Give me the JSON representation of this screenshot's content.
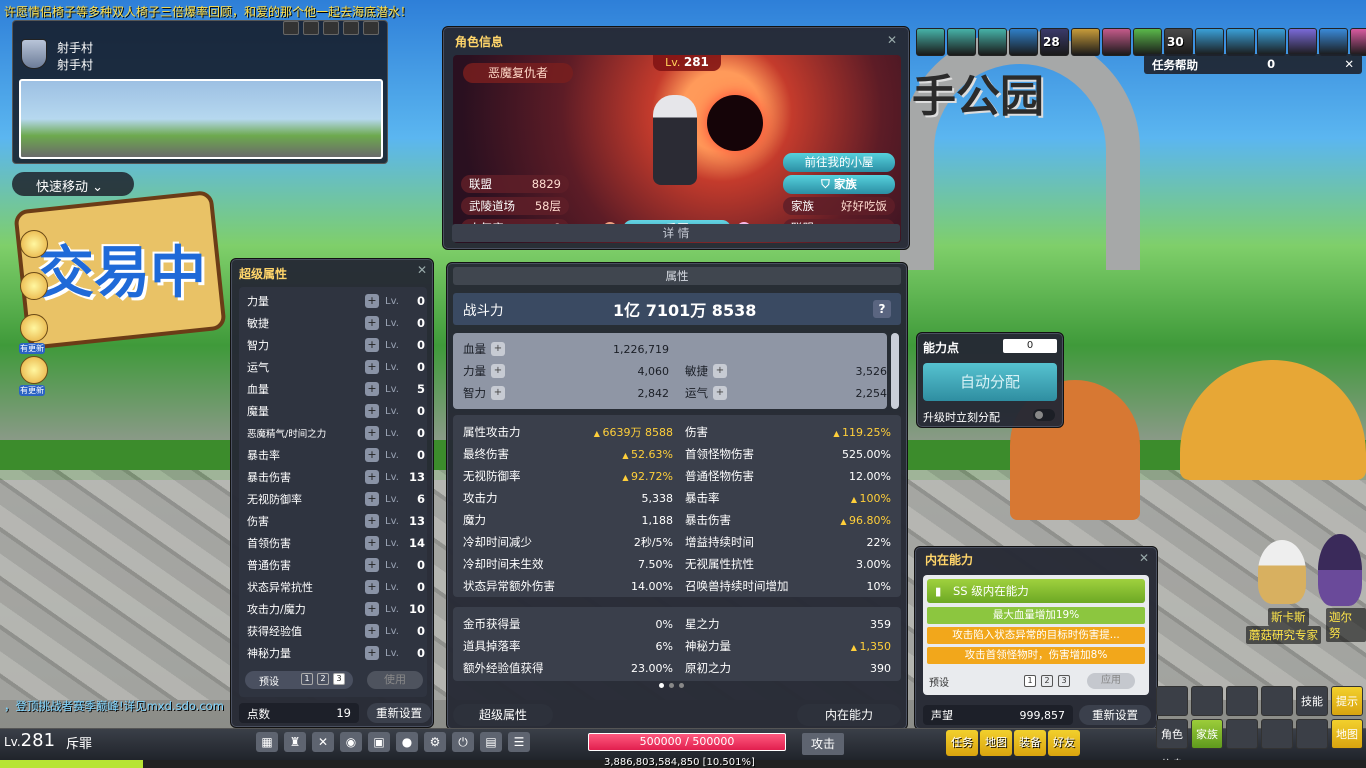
{
  "ticker": "许愿情侣椅子等多种双人椅子三倍爆率回顾，和爱的那个他一起去海底潜水！",
  "minimap": {
    "area_line1": "射手村",
    "area_line2": "射手村"
  },
  "quick_move": "快速移动",
  "side_icons": [
    {
      "icon": "lightbulb-icon",
      "badge": ""
    },
    {
      "icon": "star-icon",
      "badge": ""
    },
    {
      "icon": "bell-icon",
      "badge": "有更新"
    },
    {
      "icon": "megaphone-icon",
      "badge": "有更新"
    }
  ],
  "backdrop": {
    "sign_text": "交易中",
    "arch_text": "手公园"
  },
  "super_stats": {
    "title": "超级属性",
    "lv_label": "Lv.",
    "rows": [
      {
        "name": "力量",
        "level": "0"
      },
      {
        "name": "敏捷",
        "level": "0"
      },
      {
        "name": "智力",
        "level": "0"
      },
      {
        "name": "运气",
        "level": "0"
      },
      {
        "name": "血量",
        "level": "5"
      },
      {
        "name": "魔量",
        "level": "0"
      },
      {
        "name": "恶魔精气/时间之力",
        "level": "0"
      },
      {
        "name": "暴击率",
        "level": "0"
      },
      {
        "name": "暴击伤害",
        "level": "13"
      },
      {
        "name": "无视防御率",
        "level": "6"
      },
      {
        "name": "伤害",
        "level": "13"
      },
      {
        "name": "首领伤害",
        "level": "14"
      },
      {
        "name": "普通伤害",
        "level": "0"
      },
      {
        "name": "状态异常抗性",
        "level": "0"
      },
      {
        "name": "攻击力/魔力",
        "level": "10"
      },
      {
        "name": "获得经验值",
        "level": "0"
      },
      {
        "name": "神秘力量",
        "level": "0"
      }
    ],
    "preset_label": "预设",
    "presets": [
      "1",
      "2",
      "3"
    ],
    "use_button": "使用",
    "points_label": "点数",
    "points_value": "19",
    "reset_button": "重新设置"
  },
  "char_info": {
    "title": "角色信息",
    "class_name": "恶魔复仇者",
    "level_prefix": "Lv.",
    "level": "281",
    "home_button": "前往我的小屋",
    "family_button": "家族",
    "left_stats": [
      {
        "label": "联盟",
        "value": "8829"
      },
      {
        "label": "武陵道场",
        "value": "58层"
      },
      {
        "label": "人气度",
        "value": "8"
      }
    ],
    "right_stats": [
      {
        "label": "家族",
        "value": "好好吃饭"
      },
      {
        "label": "联盟",
        "value": "-"
      }
    ],
    "character_name": "斥罪",
    "detail_button": "详 情"
  },
  "attributes": {
    "tab": "属性",
    "combat_power_label": "战斗力",
    "combat_power_value": "1亿 7101万 8538",
    "help": "?",
    "base": {
      "hp_label": "血量",
      "hp_value": "1,226,719",
      "str_label": "力量",
      "str_value": "4,060",
      "dex_label": "敏捷",
      "dex_value": "3,526",
      "int_label": "智力",
      "int_value": "2,842",
      "luk_label": "运气",
      "luk_value": "2,254"
    },
    "advanced": [
      {
        "l": "属性攻击力",
        "lv": "6639万 8588",
        "lu": true,
        "r": "伤害",
        "rv": "119.25%",
        "ru": true
      },
      {
        "l": "最终伤害",
        "lv": "52.63%",
        "lu": true,
        "r": "首领怪物伤害",
        "rv": "525.00%",
        "ru": false
      },
      {
        "l": "无视防御率",
        "lv": "92.72%",
        "lu": true,
        "r": "普通怪物伤害",
        "rv": "12.00%",
        "ru": false
      },
      {
        "l": "攻击力",
        "lv": "5,338",
        "lu": false,
        "r": "暴击率",
        "rv": "100%",
        "ru": true
      },
      {
        "l": "魔力",
        "lv": "1,188",
        "lu": false,
        "r": "暴击伤害",
        "rv": "96.80%",
        "ru": true
      },
      {
        "l": "冷却时间减少",
        "lv": "2秒/5%",
        "lu": false,
        "r": "增益持续时间",
        "rv": "22%",
        "ru": false
      },
      {
        "l": "冷却时间未生效",
        "lv": "7.50%",
        "lu": false,
        "r": "无视属性抗性",
        "rv": "3.00%",
        "ru": false
      },
      {
        "l": "状态异常额外伤害",
        "lv": "14.00%",
        "lu": false,
        "r": "召唤兽持续时间增加",
        "rv": "10%",
        "ru": false
      }
    ],
    "misc": [
      {
        "l": "金币获得量",
        "lv": "0%",
        "lu": false,
        "r": "星之力",
        "rv": "359",
        "ru": false
      },
      {
        "l": "道具掉落率",
        "lv": "6%",
        "lu": false,
        "r": "神秘力量",
        "rv": "1,350",
        "ru": true
      },
      {
        "l": "额外经验值获得",
        "lv": "23.00%",
        "lu": false,
        "r": "原初之力",
        "rv": "390",
        "ru": false
      }
    ],
    "footer_left": "超级属性",
    "footer_right": "内在能力"
  },
  "ability_points": {
    "title": "能力点",
    "value": "0",
    "auto_button": "自动分配",
    "auto_upgrade_label": "升级时立刻分配"
  },
  "inner_ability": {
    "title": "内在能力",
    "rank": "SS 级内在能力",
    "lines": [
      {
        "text": "最大血量增加19%",
        "color": "#8cc63f"
      },
      {
        "text": "攻击陷入状态异常的目标时伤害提...",
        "color": "#f2a71b"
      },
      {
        "text": "攻击首领怪物时，伤害增加8%",
        "color": "#f2a71b"
      }
    ],
    "preset_label": "预设",
    "presets": [
      "1",
      "2",
      "3"
    ],
    "apply_button": "应用",
    "fame_label": "声望",
    "fame_value": "999,857",
    "reset_button": "重新设置"
  },
  "buffs": [
    {
      "icon": "buff-icon",
      "count": "",
      "color": "#46b2a8"
    },
    {
      "icon": "buff-icon",
      "count": "",
      "color": "#46b2a8"
    },
    {
      "icon": "buff-icon",
      "count": "",
      "color": "#46b2a8"
    },
    {
      "icon": "buff-icon",
      "count": "",
      "color": "#2f7fc8"
    },
    {
      "icon": "buff-icon",
      "count": "28",
      "color": "#3a3a6a"
    },
    {
      "icon": "buff-icon",
      "count": "",
      "color": "#c79c3a"
    },
    {
      "icon": "buff-icon",
      "count": "",
      "color": "#c45a8a"
    },
    {
      "icon": "buff-icon",
      "count": "",
      "color": "#5ab84a"
    },
    {
      "icon": "buff-icon",
      "count": "30",
      "color": "#4a4a4a"
    },
    {
      "icon": "buff-icon",
      "count": "",
      "color": "#3aa0d8"
    },
    {
      "icon": "buff-icon",
      "count": "",
      "color": "#3aa0d8"
    },
    {
      "icon": "buff-icon",
      "count": "",
      "color": "#3aa0d8"
    },
    {
      "icon": "buff-icon",
      "count": "",
      "color": "#7a6ad8"
    },
    {
      "icon": "buff-icon",
      "count": "",
      "color": "#3a8ad8"
    },
    {
      "icon": "buff-icon",
      "count": "",
      "color": "#d85aa0"
    }
  ],
  "quest_helper": {
    "title": "任务帮助",
    "value": "0"
  },
  "npcs": {
    "npc1": "斯卡斯",
    "npc2": "迦尔努",
    "npc1_title": "蘑菇研究专家"
  },
  "event_line": "，登顶挑战者赛季巅峰!详见mxd.sdo.com",
  "bottom": {
    "level_prefix": "Lv.",
    "level": "281",
    "player_name": "斥罪",
    "hp_text": "500000 / 500000",
    "hp_fraction": 1.0,
    "attack_button": "攻击",
    "exp_text": "3,886,803,584,850 [10.501%]",
    "exp_fraction": 0.10501,
    "menu_icons": [
      "▦",
      "♜",
      "✕",
      "◉",
      "▣",
      "●",
      "⚙",
      "⏻",
      "▤",
      "☰"
    ],
    "quick_buttons": [
      "任务",
      "地图",
      "装备",
      "好友"
    ],
    "slots": [
      {
        "t": "",
        "c": "d"
      },
      {
        "t": "",
        "c": "d"
      },
      {
        "t": "",
        "c": "d"
      },
      {
        "t": "",
        "c": "d"
      },
      {
        "t": "技能",
        "c": "d"
      },
      {
        "t": "提示",
        "c": "y"
      },
      {
        "t": "角色信息",
        "c": "d"
      },
      {
        "t": "家族",
        "c": "g"
      },
      {
        "t": "",
        "c": "d"
      },
      {
        "t": "",
        "c": "d"
      },
      {
        "t": "",
        "c": "d"
      },
      {
        "t": "地图",
        "c": "y"
      }
    ]
  }
}
